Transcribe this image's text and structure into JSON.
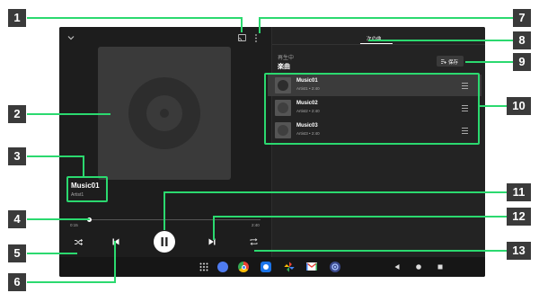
{
  "player": {
    "track_title": "Music01",
    "track_artist": "Artist1",
    "time_elapsed": "0:15",
    "time_total": "2:40",
    "progress": 0.1
  },
  "panel": {
    "tab_label": "次の曲",
    "playing_label": "再生中",
    "queue_title": "楽曲",
    "save_label": "保存",
    "queue": [
      {
        "title": "Music01",
        "sub": "Artist1 • 2:40",
        "selected": true
      },
      {
        "title": "Music02",
        "sub": "Artist2 • 2:40",
        "selected": false
      },
      {
        "title": "Music03",
        "sub": "Artist3 • 2:40",
        "selected": false
      }
    ]
  },
  "callouts": [
    "1",
    "2",
    "3",
    "4",
    "5",
    "6",
    "7",
    "8",
    "9",
    "10",
    "11",
    "12",
    "13"
  ],
  "colors": {
    "accent_green": "#2bd96f",
    "callout_bg": "#3a3a3a",
    "bg_dark": "#1d1d1d",
    "panel_bg": "#232323"
  }
}
